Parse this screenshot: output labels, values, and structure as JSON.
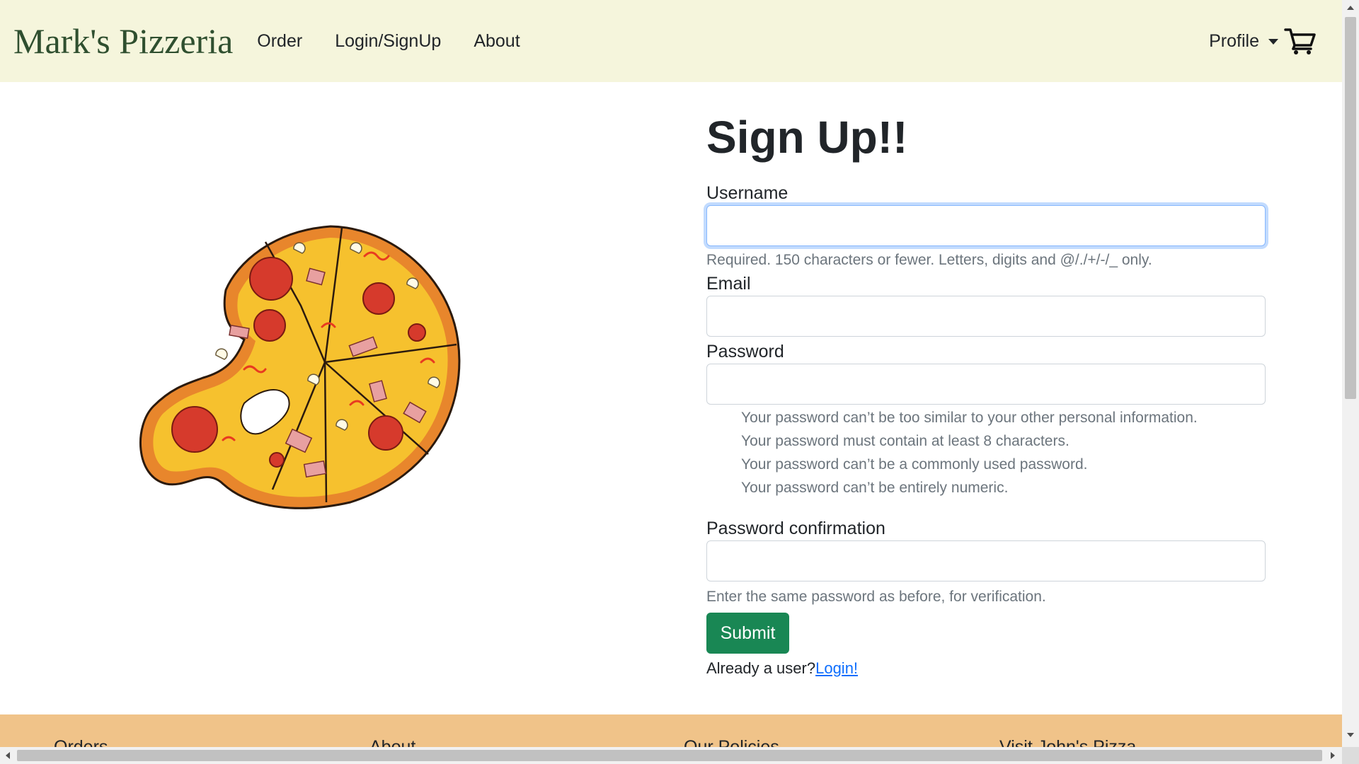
{
  "navbar": {
    "brand": "Mark's Pizzeria",
    "links": [
      "Order",
      "Login/SignUp",
      "About"
    ],
    "profile_label": "Profile",
    "cart_icon": "shopping-cart-icon"
  },
  "hero": {
    "image": "pizza-illustration"
  },
  "form": {
    "title": "Sign Up!!",
    "username_label": "Username",
    "username_value": "",
    "username_help": "Required. 150 characters or fewer. Letters, digits and @/./+/-/_ only.",
    "email_label": "Email",
    "email_value": "",
    "password_label": "Password",
    "password_value": "",
    "password_help": [
      "Your password can’t be too similar to your other personal information.",
      "Your password must contain at least 8 characters.",
      "Your password can’t be a commonly used password.",
      "Your password can’t be entirely numeric."
    ],
    "password2_label": "Password confirmation",
    "password2_value": "",
    "password2_help": "Enter the same password as before, for verification.",
    "submit_label": "Submit",
    "already_text": "Already a user?",
    "login_link": "Login!"
  },
  "footer": {
    "columns": [
      "Orders",
      "About",
      "Our Policies",
      "Visit John's Pizza"
    ]
  },
  "colors": {
    "navbar_bg": "#f5f5dc",
    "brand": "#2f4f2f",
    "submit_bg": "#198754",
    "link": "#0d6efd",
    "footer_bg": "#f0c389"
  }
}
